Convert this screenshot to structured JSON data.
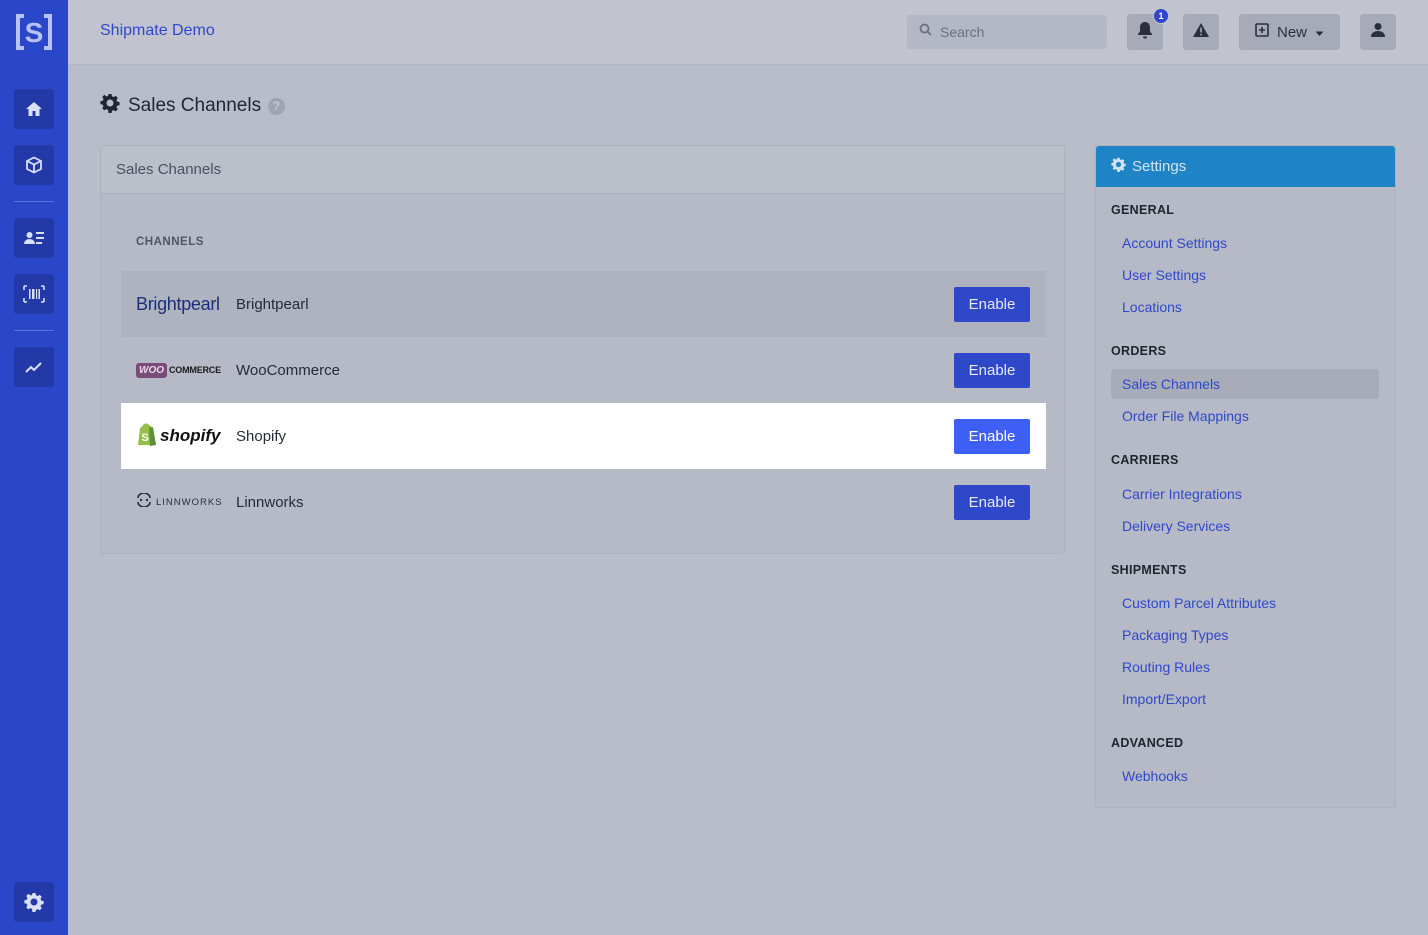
{
  "app": {
    "brand": "Shipmate Demo",
    "notification_count": "1"
  },
  "search": {
    "placeholder": "Search"
  },
  "topbar": {
    "new_label": "New"
  },
  "page": {
    "title": "Sales Channels"
  },
  "card": {
    "title": "Sales Channels",
    "section_label": "CHANNELS",
    "channels": [
      {
        "name": "Brightpearl",
        "logo_text": "Brightpearl",
        "button": "Enable"
      },
      {
        "name": "WooCommerce",
        "logo_text_a": "WOO",
        "logo_text_b": "COMMERCE",
        "button": "Enable"
      },
      {
        "name": "Shopify",
        "logo_text": "shopify",
        "button": "Enable"
      },
      {
        "name": "Linnworks",
        "logo_text": "LINNWORKS",
        "button": "Enable"
      }
    ]
  },
  "settings": {
    "title": "Settings",
    "groups": [
      {
        "label": "GENERAL",
        "items": [
          "Account Settings",
          "User Settings",
          "Locations"
        ]
      },
      {
        "label": "ORDERS",
        "items": [
          "Sales Channels",
          "Order File Mappings"
        ]
      },
      {
        "label": "CARRIERS",
        "items": [
          "Carrier Integrations",
          "Delivery Services"
        ]
      },
      {
        "label": "SHIPMENTS",
        "items": [
          "Custom Parcel Attributes",
          "Packaging Types",
          "Routing Rules",
          "Import/Export"
        ]
      },
      {
        "label": "ADVANCED",
        "items": [
          "Webhooks"
        ]
      }
    ],
    "active_item": "Sales Channels"
  },
  "colors": {
    "primary": "#2f48c9",
    "rail": "#2a46c9",
    "settings_header": "#1f84c6",
    "enable_highlight": "#3e5ff5"
  }
}
